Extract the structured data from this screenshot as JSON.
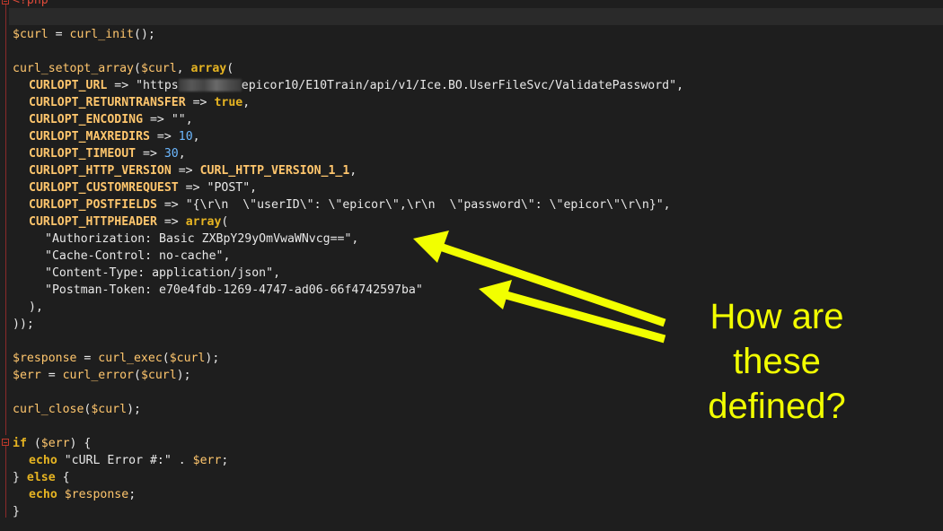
{
  "code": {
    "php_open_tag": "<?php",
    "line_curl_init": {
      "var": "$curl",
      "op": " = ",
      "fn": "curl_init",
      "rest": "();"
    },
    "line_setopt_open": {
      "fn": "curl_setopt_array",
      "p1": "(",
      "var": "$curl",
      "p2": ", ",
      "kw": "array",
      "p3": "("
    },
    "opt_url": {
      "name": "CURLOPT_URL",
      "arrow": " => ",
      "str_a": "\"https",
      "str_b": "epicor10/E10Train/api/v1/Ice.BO.UserFileSvc/ValidatePassword\"",
      "tail": ","
    },
    "opt_returntransfer": {
      "name": "CURLOPT_RETURNTRANSFER",
      "arrow": " => ",
      "val": "true",
      "tail": ","
    },
    "opt_encoding": {
      "name": "CURLOPT_ENCODING",
      "arrow": " => ",
      "val": "\"\"",
      "tail": ","
    },
    "opt_maxredirs": {
      "name": "CURLOPT_MAXREDIRS",
      "arrow": " => ",
      "val": "10",
      "tail": ","
    },
    "opt_timeout": {
      "name": "CURLOPT_TIMEOUT",
      "arrow": " => ",
      "val": "30",
      "tail": ","
    },
    "opt_http_version": {
      "name": "CURLOPT_HTTP_VERSION",
      "arrow": " => ",
      "val": "CURL_HTTP_VERSION_1_1",
      "tail": ","
    },
    "opt_customrequest": {
      "name": "CURLOPT_CUSTOMREQUEST",
      "arrow": " => ",
      "val": "\"POST\"",
      "tail": ","
    },
    "opt_postfields": {
      "name": "CURLOPT_POSTFIELDS",
      "arrow": " => ",
      "val": "\"{\\r\\n  \\\"userID\\\": \\\"epicor\\\",\\r\\n  \\\"password\\\": \\\"epicor\\\"\\r\\n}\"",
      "tail": ","
    },
    "opt_httpheader": {
      "name": "CURLOPT_HTTPHEADER",
      "arrow": " => ",
      "kw": "array",
      "tail": "("
    },
    "header_auth": {
      "val": "\"Authorization: Basic ZXBpY29yOmVwaWNvcg==\"",
      "tail": ","
    },
    "header_cache": {
      "val": "\"Cache-Control: no-cache\"",
      "tail": ","
    },
    "header_content_type": {
      "val": "\"Content-Type: application/json\"",
      "tail": ","
    },
    "header_postman": {
      "val": "\"Postman-Token: e70e4fdb-1269-4747-ad06-66f4742597ba\""
    },
    "close_inner": "),",
    "close_outer": "));",
    "line_response": {
      "var": "$response",
      "op": " = ",
      "fn": "curl_exec",
      "p1": "(",
      "var2": "$curl",
      "p2": ");"
    },
    "line_err": {
      "var": "$err",
      "op": " = ",
      "fn": "curl_error",
      "p1": "(",
      "var2": "$curl",
      "p2": ");"
    },
    "line_close": {
      "fn": "curl_close",
      "p1": "(",
      "var": "$curl",
      "p2": ");"
    },
    "line_if": {
      "kw": "if",
      "p1": " (",
      "var": "$err",
      "p2": ") {"
    },
    "line_echo_err": {
      "kw": "echo",
      "str": " \"cURL Error #:\"",
      "op": " . ",
      "var": "$err",
      "tail": ";"
    },
    "line_else": {
      "p1": "} ",
      "kw": "else",
      "p2": " {"
    },
    "line_echo_resp": {
      "kw": "echo",
      "sp": " ",
      "var": "$response",
      "tail": ";"
    },
    "line_end": "}"
  },
  "annotation": {
    "text_line1": "How are",
    "text_line2": "these",
    "text_line3": "defined?",
    "color": "#f2ff00"
  }
}
